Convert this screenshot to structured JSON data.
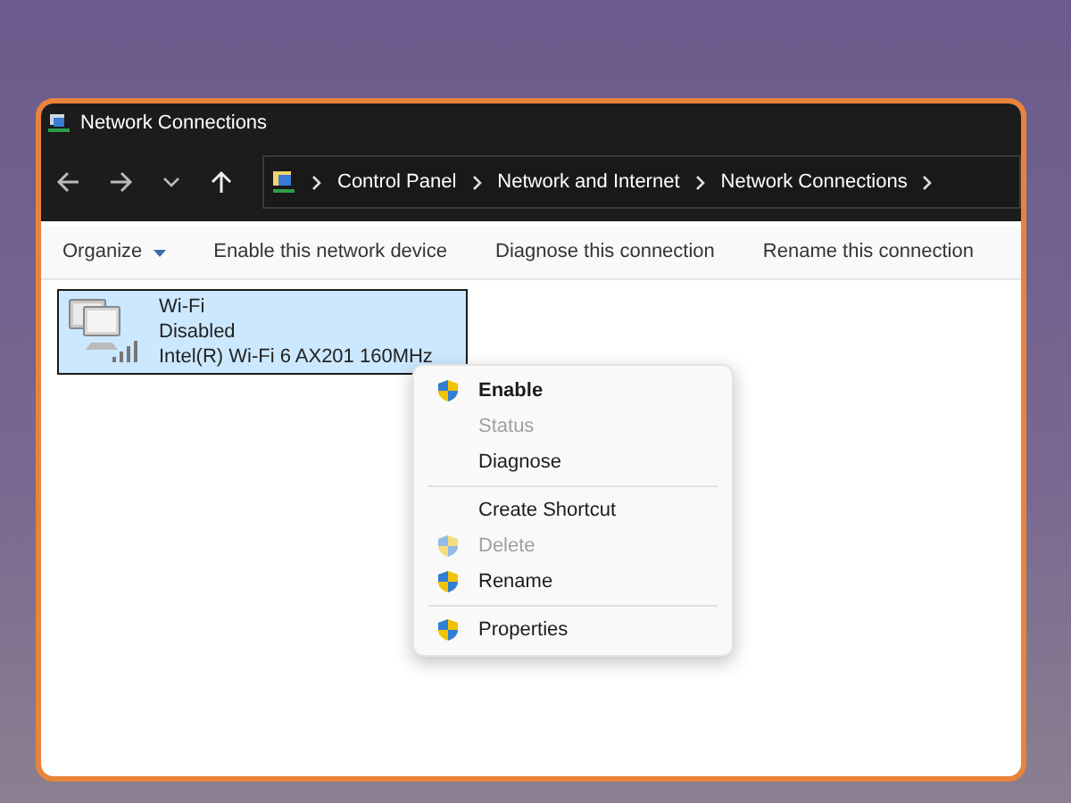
{
  "window": {
    "title": "Network Connections"
  },
  "breadcrumb": [
    "Control Panel",
    "Network and Internet",
    "Network Connections"
  ],
  "toolbar": [
    {
      "label": "Organize",
      "kind": "dropdown"
    },
    {
      "label": "Enable this network device",
      "kind": "command"
    },
    {
      "label": "Diagnose this connection",
      "kind": "command"
    },
    {
      "label": "Rename this connection",
      "kind": "command"
    }
  ],
  "connection": {
    "name": "Wi-Fi",
    "status": "Disabled",
    "adapter": "Intel(R) Wi-Fi 6 AX201 160MHz",
    "selected": true
  },
  "context_menu": {
    "groups": [
      [
        {
          "label": "Enable",
          "shield": true,
          "default": true,
          "disabled": false
        },
        {
          "label": "Status",
          "shield": false,
          "default": false,
          "disabled": true
        },
        {
          "label": "Diagnose",
          "shield": false,
          "default": false,
          "disabled": false
        }
      ],
      [
        {
          "label": "Create Shortcut",
          "shield": false,
          "default": false,
          "disabled": false
        },
        {
          "label": "Delete",
          "shield": true,
          "default": false,
          "disabled": true
        },
        {
          "label": "Rename",
          "shield": true,
          "default": false,
          "disabled": false
        }
      ],
      [
        {
          "label": "Properties",
          "shield": true,
          "default": false,
          "disabled": false
        }
      ]
    ]
  }
}
